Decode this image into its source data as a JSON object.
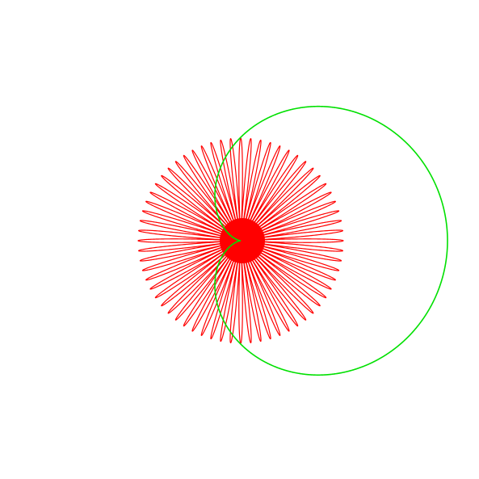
{
  "figure": {
    "background": "#ffffff",
    "rose": {
      "color": "#ff0000",
      "curve": "rose",
      "petals": 64
    },
    "cardioid": {
      "color": "#00e000",
      "curve": "cardioid"
    }
  }
}
